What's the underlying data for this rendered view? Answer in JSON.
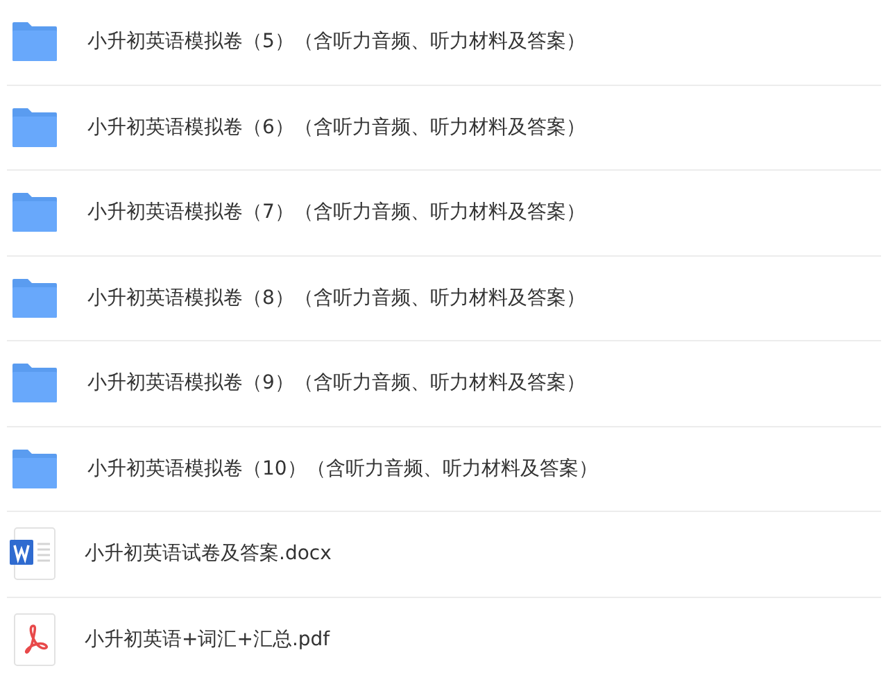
{
  "files": [
    {
      "kind": "folder",
      "name": "小升初英语模拟卷（5）（含听力音频、听力材料及答案）"
    },
    {
      "kind": "folder",
      "name": "小升初英语模拟卷（6）（含听力音频、听力材料及答案）"
    },
    {
      "kind": "folder",
      "name": "小升初英语模拟卷（7）（含听力音频、听力材料及答案）"
    },
    {
      "kind": "folder",
      "name": "小升初英语模拟卷（8）（含听力音频、听力材料及答案）"
    },
    {
      "kind": "folder",
      "name": "小升初英语模拟卷（9）（含听力音频、听力材料及答案）"
    },
    {
      "kind": "folder",
      "name": "小升初英语模拟卷（10）（含听力音频、听力材料及答案）"
    },
    {
      "kind": "docx",
      "name": "小升初英语试卷及答案.docx"
    },
    {
      "kind": "pdf",
      "name": "小升初英语+词汇+汇总.pdf"
    }
  ]
}
